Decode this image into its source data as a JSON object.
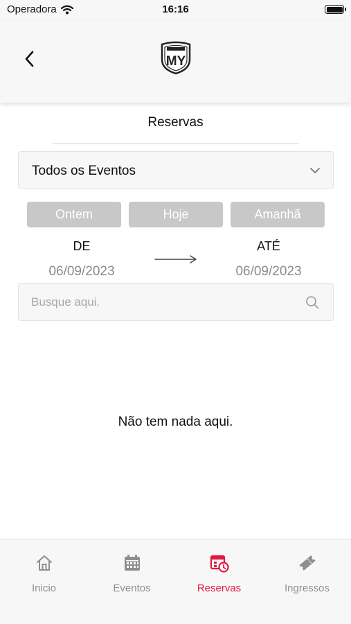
{
  "status_bar": {
    "carrier": "Operadora",
    "time": "16:16"
  },
  "nav": {
    "back_icon": "chevron-left-icon",
    "logo": "MY"
  },
  "page": {
    "title": "Reservas"
  },
  "filter": {
    "selected_event": "Todos os Eventos"
  },
  "quick_dates": {
    "yesterday": "Ontem",
    "today": "Hoje",
    "tomorrow": "Amanhã"
  },
  "date_range": {
    "from_label": "DE",
    "from_value": "06/09/2023",
    "to_label": "ATÉ",
    "to_value": "06/09/2023"
  },
  "search": {
    "placeholder": "Busque aqui.",
    "value": ""
  },
  "empty_state": "Não tem nada aqui.",
  "tabs": [
    {
      "label": "Inicio",
      "icon": "home-icon",
      "active": false
    },
    {
      "label": "Eventos",
      "icon": "calendar-icon",
      "active": false
    },
    {
      "label": "Reservas",
      "icon": "reservation-icon",
      "active": true
    },
    {
      "label": "Ingressos",
      "icon": "ticket-icon",
      "active": false
    }
  ],
  "colors": {
    "accent": "#e3173e",
    "inactive": "#8e8e8e",
    "button_gray": "#c8c8c8",
    "background": "#f7f7f7"
  }
}
